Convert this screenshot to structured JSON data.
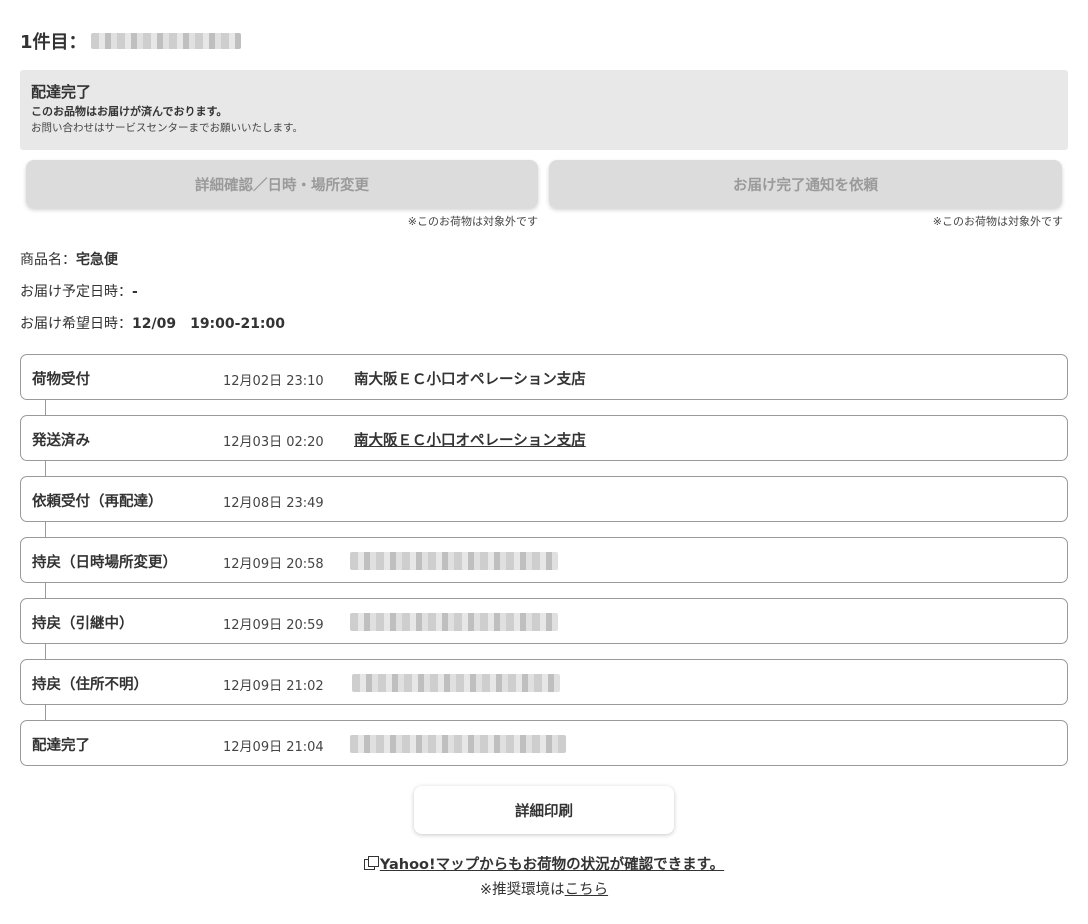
{
  "header": {
    "item_count_label": "1件目："
  },
  "status": {
    "title": "配達完了",
    "message": "このお品物はお届けが済んでおります。",
    "note": "お問い合わせはサービスセンターまでお願いいたします。"
  },
  "actions": {
    "detail_change_label": "詳細確認／日時・場所変更",
    "detail_change_note": "※このお荷物は対象外です",
    "completion_notice_label": "お届け完了通知を依頼",
    "completion_notice_note": "※このお荷物は対象外です"
  },
  "info": {
    "product_label": "商品名：",
    "product_value": "宅急便",
    "scheduled_label": "お届け予定日時：",
    "scheduled_value": "-",
    "requested_label": "お届け希望日時：",
    "requested_value": "12/09　19:00-21:00"
  },
  "timeline": [
    {
      "status": "荷物受付",
      "time": "12月02日 23:10",
      "place": "南大阪ＥＣ小口オペレーション支店"
    },
    {
      "status": "発送済み",
      "time": "12月03日 02:20",
      "place": "南大阪ＥＣ小口オペレーション支店"
    },
    {
      "status": "依頼受付（再配達）",
      "time": "12月08日 23:49",
      "place": ""
    },
    {
      "status": "持戻（日時場所変更）",
      "time": "12月09日 20:58",
      "place": ""
    },
    {
      "status": "持戻（引継中）",
      "time": "12月09日 20:59",
      "place": ""
    },
    {
      "status": "持戻（住所不明）",
      "time": "12月09日 21:02",
      "place": ""
    },
    {
      "status": "配達完了",
      "time": "12月09日 21:04",
      "place": ""
    }
  ],
  "print_button": {
    "label": "詳細印刷"
  },
  "footer": {
    "map_link": "Yahoo!マップからもお荷物の状況が確認できます。",
    "env_prefix": "※推奨環境は",
    "env_link": "こちら"
  },
  "icons": {
    "map_link_icon": "copy-icon"
  }
}
